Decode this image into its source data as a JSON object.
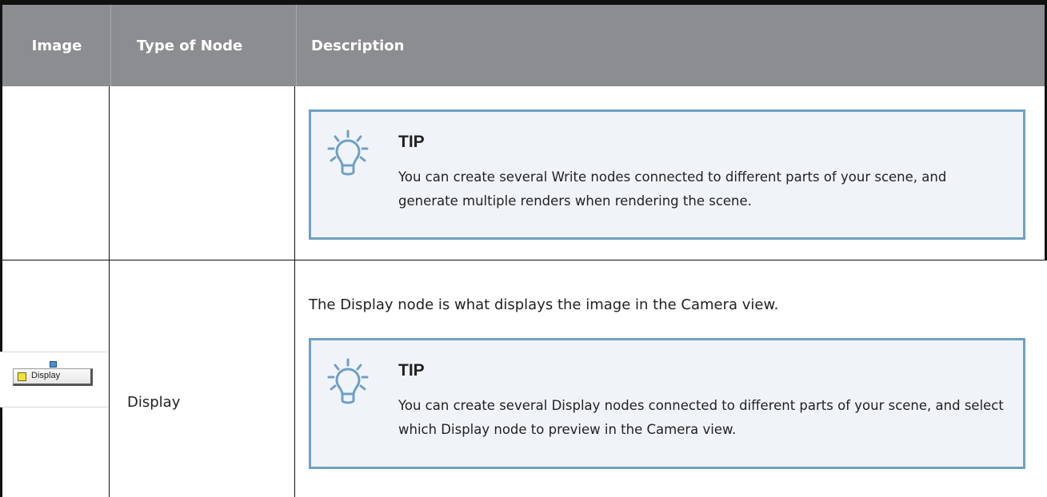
{
  "table": {
    "headers": {
      "image": "Image",
      "type_of_node": "Type of Node",
      "description": "Description"
    },
    "rows": [
      {
        "image": "",
        "type_of_node": "",
        "tip": {
          "title": "TIP",
          "text": "You can create several Write nodes connected to different parts of your scene, and generate multiple renders when rendering the scene."
        }
      },
      {
        "image": {
          "node_label": "Display",
          "icon": "display-node-thumbnail"
        },
        "type_of_node": "Display",
        "description": "The Display node is what displays the image in the Camera view.",
        "tip": {
          "title": "TIP",
          "text": "You can create several Display nodes connected to different parts of your scene, and select which Display node to preview in the Camera view."
        }
      }
    ]
  },
  "icons": {
    "tip": "lightbulb-icon"
  },
  "colors": {
    "header_bg": "#8c8d90",
    "header_text": "#ffffff",
    "tip_border": "#6fa0c4",
    "tip_bg": "#f0f4f8",
    "tip_icon": "#6fa0c4"
  }
}
